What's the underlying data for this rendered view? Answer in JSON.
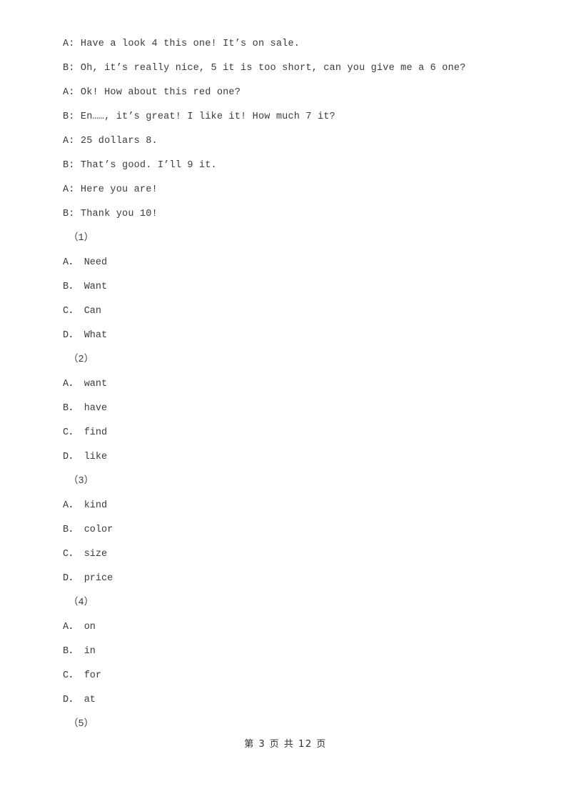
{
  "document": {
    "dialogue": [
      "A: Have a look 4 this one! It’s on sale.",
      "B: Oh, it’s really nice, 5 it is too short, can you give me a 6 one?",
      "A: Ok! How about this red one?",
      "B: En……, it’s great! I like it! How much 7 it?",
      "A: 25 dollars 8.",
      "B: That’s good. I’ll 9 it.",
      "A: Here you are!",
      "B: Thank you 10!"
    ],
    "questions": [
      {
        "number": "（1）",
        "options": [
          "A． Need",
          "B． Want",
          "C． Can",
          "D． What"
        ]
      },
      {
        "number": "（2）",
        "options": [
          "A． want",
          "B． have",
          "C． find",
          "D． like"
        ]
      },
      {
        "number": "（3）",
        "options": [
          "A． kind",
          "B． color",
          "C． size",
          "D． price"
        ]
      },
      {
        "number": "（4）",
        "options": [
          "A． on",
          "B． in",
          "C． for",
          "D． at"
        ]
      },
      {
        "number": "（5）",
        "options": []
      }
    ],
    "footer": "第 3 页 共 12 页"
  }
}
